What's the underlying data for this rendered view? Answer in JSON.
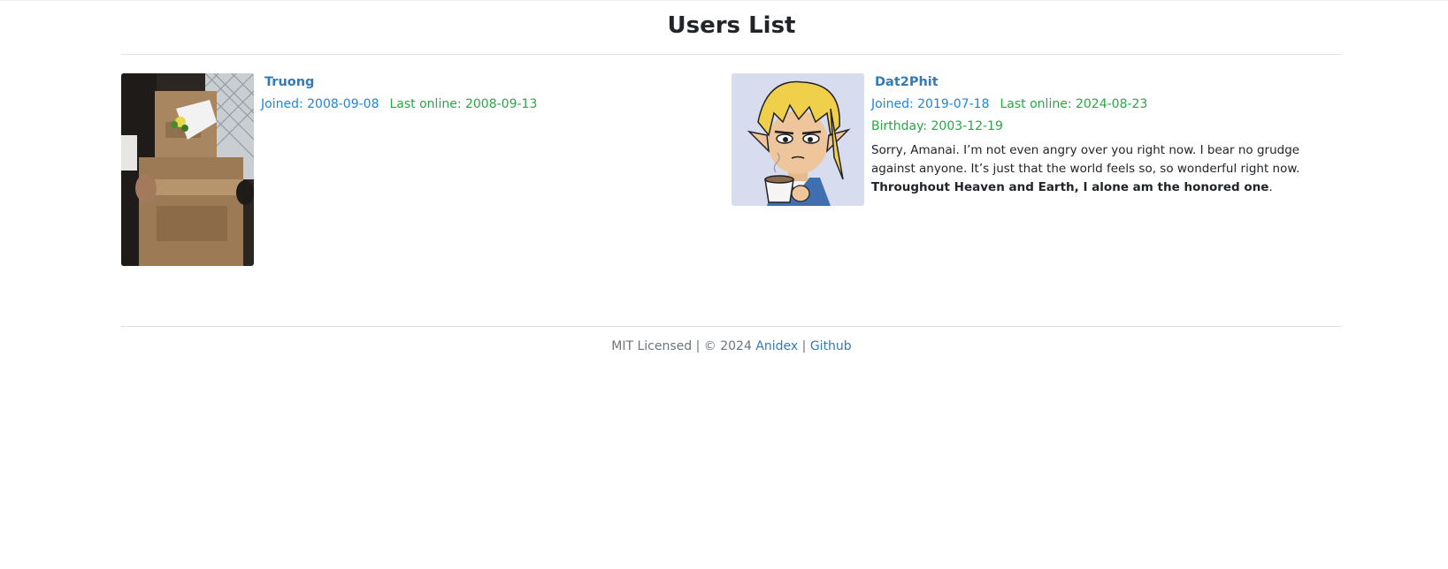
{
  "page": {
    "title": "Users List"
  },
  "users": [
    {
      "username": "Truong",
      "joined_label": "Joined: 2008-09-08",
      "last_online_label": "Last online: 2008-09-13",
      "avatar_icon": "photo-box-costume"
    },
    {
      "username": "Dat2Phit",
      "joined_label": "Joined: 2019-07-18",
      "last_online_label": "Last online: 2024-08-23",
      "birthday_label": "Birthday: 2003-12-19",
      "bio_plain": "Sorry, Amanai. I’m not even angry over you right now. I bear no grudge against anyone. It’s just that the world feels so, so wonderful right now. ",
      "bio_bold": "Throughout Heaven and Earth, I alone am the honored one",
      "bio_end": ".",
      "avatar_icon": "cartoon-elf-with-cup"
    }
  ],
  "footer": {
    "license_text": "MIT Licensed | © 2024 ",
    "author_link": "Anidex",
    "separator": " | ",
    "github_link": "Github"
  },
  "colors": {
    "link": "#337ab7",
    "joined": "#1c86e0",
    "online": "#28a745",
    "muted": "#6c757d"
  }
}
